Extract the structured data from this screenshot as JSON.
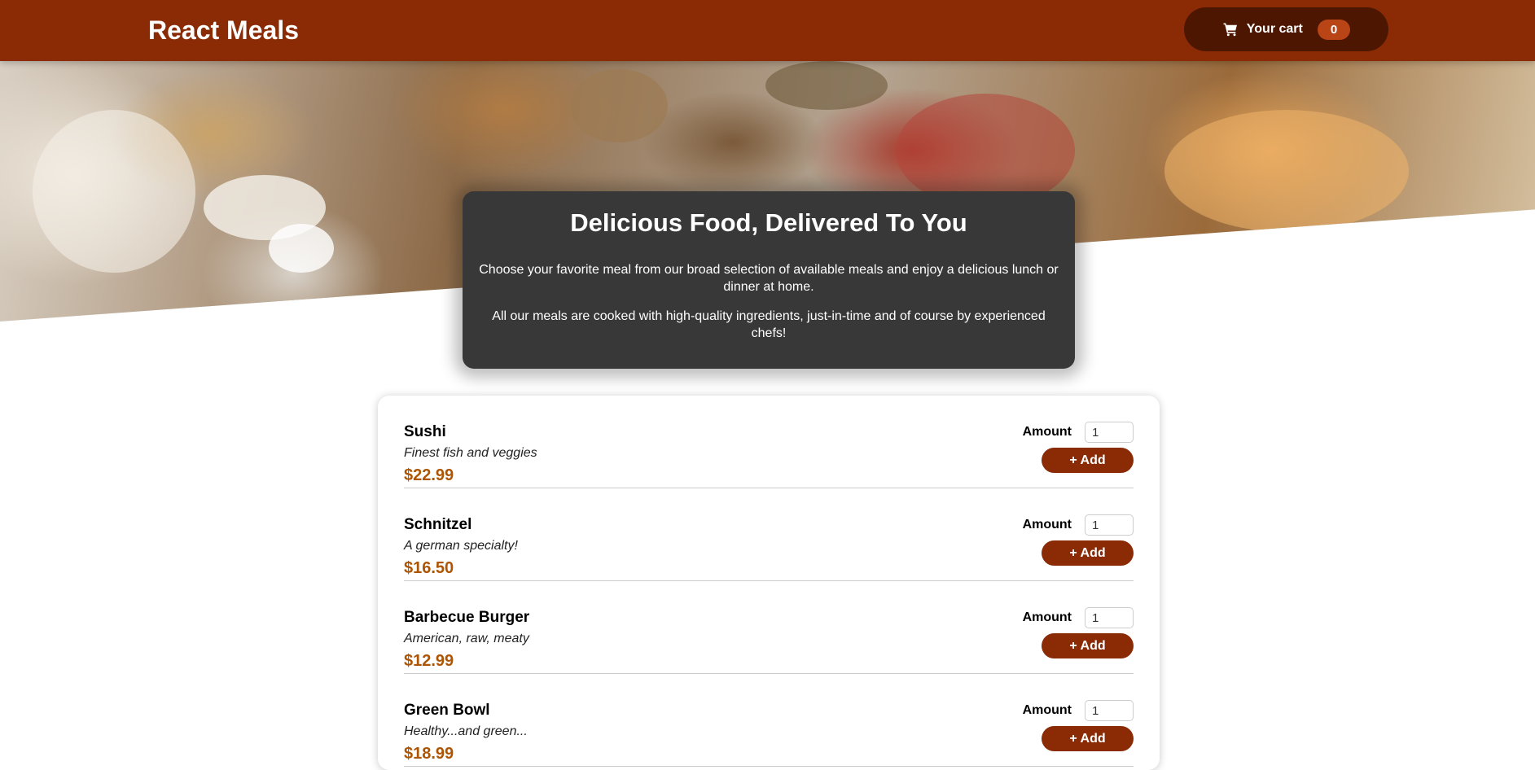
{
  "header": {
    "brand": "React Meals",
    "cart": {
      "label": "Your cart",
      "count": "0",
      "icon": "cart-icon"
    }
  },
  "summary": {
    "title": "Delicious Food, Delivered To You",
    "paragraph1": "Choose your favorite meal from our broad selection of available meals and enjoy a delicious lunch or dinner at home.",
    "paragraph2": "All our meals are cooked with high-quality ingredients, just-in-time and of course by experienced chefs!"
  },
  "meals": [
    {
      "name": "Sushi",
      "description": "Finest fish and veggies",
      "price": "$22.99",
      "amount_label": "Amount",
      "amount": "1",
      "add_label": "+ Add"
    },
    {
      "name": "Schnitzel",
      "description": "A german specialty!",
      "price": "$16.50",
      "amount_label": "Amount",
      "amount": "1",
      "add_label": "+ Add"
    },
    {
      "name": "Barbecue Burger",
      "description": "American, raw, meaty",
      "price": "$12.99",
      "amount_label": "Amount",
      "amount": "1",
      "add_label": "+ Add"
    },
    {
      "name": "Green Bowl",
      "description": "Healthy...and green...",
      "price": "$18.99",
      "amount_label": "Amount",
      "amount": "1",
      "add_label": "+ Add"
    }
  ],
  "colors": {
    "header": "#8a2b06",
    "cart_button": "#4d1601",
    "badge": "#b94517",
    "price": "#ad5502",
    "summary_bg": "#383838"
  }
}
